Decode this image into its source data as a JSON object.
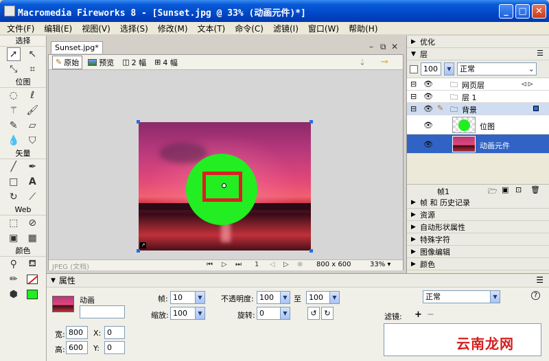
{
  "window": {
    "title": "Macromedia Fireworks 8 - [Sunset.jpg @  33% (动画元件)*]"
  },
  "menu": [
    "文件(F)",
    "编辑(E)",
    "视图(V)",
    "选择(S)",
    "修改(M)",
    "文本(T)",
    "命令(C)",
    "滤镜(I)",
    "窗口(W)",
    "帮助(H)"
  ],
  "toolbox": {
    "sections": [
      "选择",
      "位图",
      "矢量",
      "Web",
      "颜色"
    ]
  },
  "document": {
    "tab": "Sunset.jpg*",
    "views": [
      "原始",
      "预览",
      "2 幅",
      "4 幅"
    ],
    "status_format": "JPEG (文档)",
    "frame": "1",
    "dims": "800 x 600",
    "zoom": "33%"
  },
  "panels": {
    "optimize": "优化",
    "layers": "层",
    "opacity": "100",
    "blend": "正常",
    "layer_rows": [
      {
        "label": "网页层"
      },
      {
        "label": "层 1"
      },
      {
        "label": "背景"
      }
    ],
    "objects": [
      {
        "label": "位图"
      },
      {
        "label": "动画元件"
      }
    ],
    "frame_label": "帧1",
    "collapsed": [
      "帧 和 历史记录",
      "资源",
      "自动形状属性",
      "特殊字符",
      "图像编辑",
      "颜色"
    ]
  },
  "properties": {
    "header": "属性",
    "symbol_type": "动画",
    "name_value": "",
    "frame_label": "帧:",
    "frame_value": "10",
    "scale_label": "缩放:",
    "scale_value": "100",
    "opacity_label": "不透明度:",
    "opacity_from": "100",
    "to_label": "至",
    "opacity_to": "100",
    "rotate_label": "旋转:",
    "rotate_value": "0",
    "blend_mode": "正常",
    "filters_label": "滤镜:",
    "w_label": "宽:",
    "w_value": "800",
    "x_label": "X:",
    "x_value": "0",
    "h_label": "高:",
    "h_value": "600",
    "y_label": "Y:",
    "y_value": "0",
    "help": "?"
  },
  "watermark": "云南龙网",
  "colors": {
    "fill": "#22ee22",
    "stroke": "#d92020"
  }
}
